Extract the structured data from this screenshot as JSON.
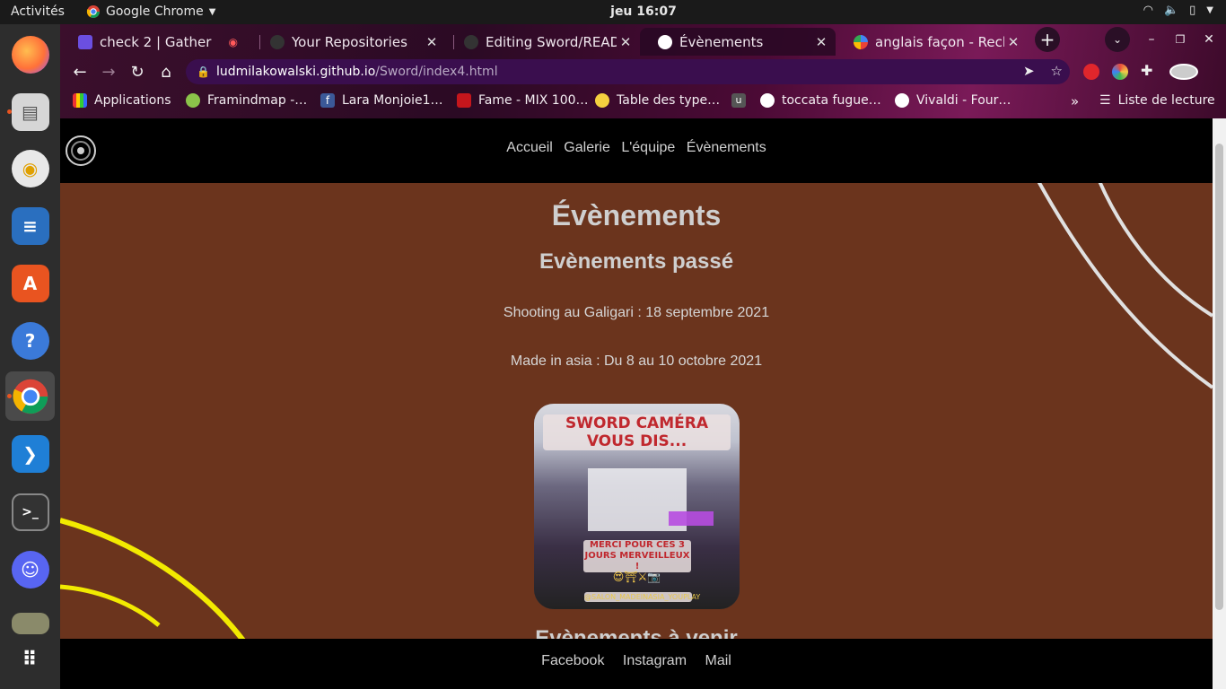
{
  "system_bar": {
    "activities": "Activités",
    "app_name": "Google Chrome",
    "clock": "jeu 16:07"
  },
  "browser": {
    "tabs": [
      {
        "title": "check 2 | Gather",
        "active": false
      },
      {
        "title": "Your Repositories",
        "active": false
      },
      {
        "title": "Editing Sword/READM",
        "active": false
      },
      {
        "title": "Évènements",
        "active": true
      },
      {
        "title": "anglais façon - Recher",
        "active": false
      }
    ],
    "url_host": "ludmilakowalski.github.io",
    "url_path": "/Sword/index4.html",
    "bookmarks": [
      "Applications",
      "Framindmap -…",
      "Lara Monjoie1…",
      "Fame - MIX 100…",
      "Table des type…",
      "toccata fugue…",
      "Vivaldi - Four…"
    ],
    "more_bookmarks": "»",
    "reading_list": "Liste de lecture"
  },
  "site": {
    "nav": [
      "Accueil",
      "Galerie",
      "L'équipe",
      "Évènements"
    ],
    "title": "Évènements",
    "past_heading": "Evènements passé",
    "events": [
      "Shooting au Galigari : 18 septembre 2021",
      "Made in asia : Du 8 au 10 octobre 2021"
    ],
    "image": {
      "headline": "SWORD CAMÉRA VOUS DIS...",
      "thanks": "MERCI POUR CES 3 JOURS MERVEILLEUX !",
      "handle": "@SALON_MADEINASIA_YOUPLAY"
    },
    "upcoming_heading": "Evènements à venir",
    "footer": [
      "Facebook",
      "Instagram",
      "Mail"
    ]
  },
  "colors": {
    "page_bg": "#6b341d",
    "nav_bg": "#000000",
    "text": "#d0d0d0",
    "yellow_stroke": "#f2ea00"
  }
}
